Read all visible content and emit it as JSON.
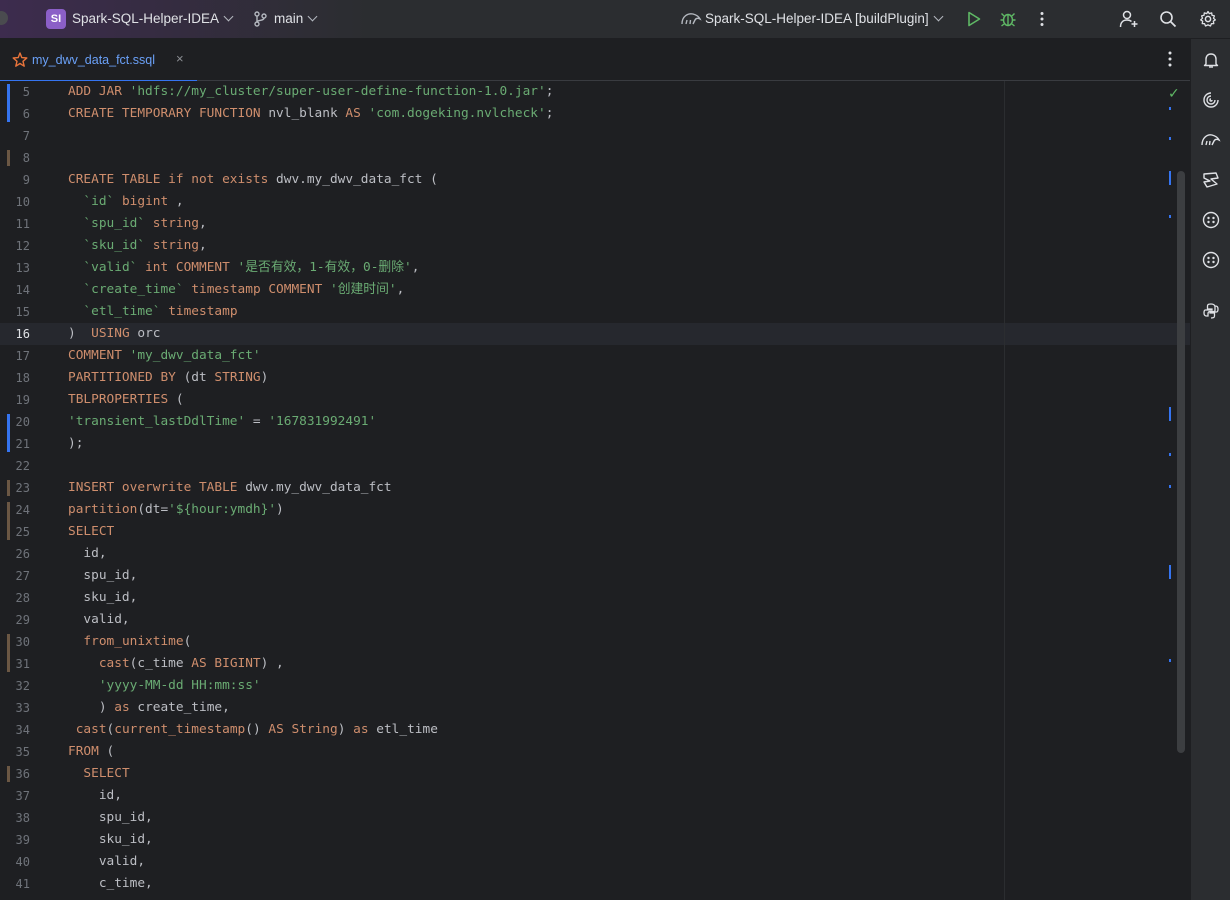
{
  "titlebar": {
    "project_badge": "SI",
    "project_name": "Spark-SQL-Helper-IDEA",
    "branch": "main",
    "run_config": "Spark-SQL-Helper-IDEA [buildPlugin]",
    "icons": [
      "branch-icon",
      "gradle-icon",
      "run-icon",
      "debug-icon",
      "more-vert-icon",
      "add-user-icon",
      "search-icon",
      "settings-icon"
    ]
  },
  "tabs": [
    {
      "label": "my_dwv_data_fct.ssql",
      "active": true,
      "close": "×"
    }
  ],
  "right_toolbar": {
    "icons": [
      "notifications-icon",
      "ai-assistant-icon",
      "gradle-icon",
      "database-icon",
      "plugin-icon",
      "plugin-icon-2",
      "python-console-icon"
    ]
  },
  "editor": {
    "current_line": 16,
    "lines": [
      {
        "n": "5",
        "tokens": [
          [
            "kw",
            "ADD JAR "
          ],
          [
            "str",
            "'hdfs://my_cluster/super-user-define-function-1.0.jar'"
          ],
          [
            "pl",
            ";"
          ]
        ]
      },
      {
        "n": "6",
        "tokens": [
          [
            "kw",
            "CREATE TEMPORARY FUNCTION "
          ],
          [
            "pl",
            "nvl_blank "
          ],
          [
            "kw",
            "AS "
          ],
          [
            "str",
            "'com.dogeking.nvlcheck'"
          ],
          [
            "pl",
            ";"
          ]
        ]
      },
      {
        "n": "7",
        "tokens": []
      },
      {
        "n": "8",
        "tokens": []
      },
      {
        "n": "9",
        "tokens": [
          [
            "kw",
            "CREATE TABLE if not exists "
          ],
          [
            "pl",
            "dwv.my_dwv_data_fct ("
          ]
        ]
      },
      {
        "n": "10",
        "tokens": [
          [
            "pl",
            "  "
          ],
          [
            "str",
            "`id`"
          ],
          [
            "pl",
            " "
          ],
          [
            "kw",
            "bigint"
          ],
          [
            "pl",
            " ,"
          ]
        ]
      },
      {
        "n": "11",
        "tokens": [
          [
            "pl",
            "  "
          ],
          [
            "str",
            "`spu_id`"
          ],
          [
            "pl",
            " "
          ],
          [
            "kw",
            "string"
          ],
          [
            "pl",
            ","
          ]
        ]
      },
      {
        "n": "12",
        "tokens": [
          [
            "pl",
            "  "
          ],
          [
            "str",
            "`sku_id`"
          ],
          [
            "pl",
            " "
          ],
          [
            "kw",
            "string"
          ],
          [
            "pl",
            ","
          ]
        ]
      },
      {
        "n": "13",
        "tokens": [
          [
            "pl",
            "  "
          ],
          [
            "str",
            "`valid`"
          ],
          [
            "pl",
            " "
          ],
          [
            "kw",
            "int COMMENT "
          ],
          [
            "str",
            "'是否有效，1-有效，0-删除'"
          ],
          [
            "pl",
            ","
          ]
        ]
      },
      {
        "n": "14",
        "tokens": [
          [
            "pl",
            "  "
          ],
          [
            "str",
            "`create_time`"
          ],
          [
            "pl",
            " "
          ],
          [
            "kw",
            "timestamp COMMENT "
          ],
          [
            "str",
            "'创建时间'"
          ],
          [
            "pl",
            ","
          ]
        ]
      },
      {
        "n": "15",
        "tokens": [
          [
            "pl",
            "  "
          ],
          [
            "str",
            "`etl_time`"
          ],
          [
            "pl",
            " "
          ],
          [
            "kw",
            "timestamp"
          ]
        ]
      },
      {
        "n": "16",
        "tokens": [
          [
            "pl",
            ")  "
          ],
          [
            "kw",
            "USING "
          ],
          [
            "pl",
            "orc"
          ]
        ]
      },
      {
        "n": "17",
        "tokens": [
          [
            "kw",
            "COMMENT "
          ],
          [
            "str",
            "'my_dwv_data_fct'"
          ]
        ]
      },
      {
        "n": "18",
        "tokens": [
          [
            "kw",
            "PARTITIONED BY "
          ],
          [
            "pl",
            "(dt "
          ],
          [
            "kw",
            "STRING"
          ],
          [
            "pl",
            ")"
          ]
        ]
      },
      {
        "n": "19",
        "tokens": [
          [
            "kw",
            "TBLPROPERTIES "
          ],
          [
            "pl",
            "("
          ]
        ]
      },
      {
        "n": "20",
        "tokens": [
          [
            "str",
            "'transient_lastDdlTime'"
          ],
          [
            "pl",
            " = "
          ],
          [
            "str",
            "'167831992491'"
          ]
        ]
      },
      {
        "n": "21",
        "tokens": [
          [
            "pl",
            ");"
          ]
        ]
      },
      {
        "n": "22",
        "tokens": []
      },
      {
        "n": "23",
        "tokens": [
          [
            "kw",
            "INSERT overwrite TABLE "
          ],
          [
            "pl",
            "dwv.my_dwv_data_fct"
          ]
        ]
      },
      {
        "n": "24",
        "tokens": [
          [
            "fnc",
            "partition"
          ],
          [
            "pl",
            "(dt="
          ],
          [
            "str",
            "'${hour:ymdh}'"
          ],
          [
            "pl",
            ")"
          ]
        ]
      },
      {
        "n": "25",
        "tokens": [
          [
            "kw",
            "SELECT"
          ]
        ]
      },
      {
        "n": "26",
        "tokens": [
          [
            "pl",
            "  id,"
          ]
        ]
      },
      {
        "n": "27",
        "tokens": [
          [
            "pl",
            "  spu_id,"
          ]
        ]
      },
      {
        "n": "28",
        "tokens": [
          [
            "pl",
            "  sku_id,"
          ]
        ]
      },
      {
        "n": "29",
        "tokens": [
          [
            "pl",
            "  valid,"
          ]
        ]
      },
      {
        "n": "30",
        "tokens": [
          [
            "pl",
            "  "
          ],
          [
            "fnc",
            "from_unixtime"
          ],
          [
            "pl",
            "("
          ]
        ]
      },
      {
        "n": "31",
        "tokens": [
          [
            "pl",
            "    "
          ],
          [
            "fnc",
            "cast"
          ],
          [
            "pl",
            "(c_time "
          ],
          [
            "kw",
            "AS BIGINT"
          ],
          [
            "pl",
            ") ,"
          ]
        ]
      },
      {
        "n": "32",
        "tokens": [
          [
            "pl",
            "    "
          ],
          [
            "str",
            "'yyyy-MM-dd HH:mm:ss'"
          ]
        ]
      },
      {
        "n": "33",
        "tokens": [
          [
            "pl",
            "    ) "
          ],
          [
            "kw",
            "as "
          ],
          [
            "pl",
            "create_time,"
          ]
        ]
      },
      {
        "n": "34",
        "tokens": [
          [
            "pl",
            " "
          ],
          [
            "fnc",
            "cast"
          ],
          [
            "pl",
            "("
          ],
          [
            "fnc",
            "current_timestamp"
          ],
          [
            "pl",
            "() "
          ],
          [
            "kw",
            "AS String"
          ],
          [
            "pl",
            ") "
          ],
          [
            "kw",
            "as "
          ],
          [
            "pl",
            "etl_time"
          ]
        ]
      },
      {
        "n": "35",
        "tokens": [
          [
            "kw",
            "FROM "
          ],
          [
            "pl",
            "("
          ]
        ]
      },
      {
        "n": "36",
        "tokens": [
          [
            "pl",
            "  "
          ],
          [
            "kw",
            "SELECT"
          ]
        ]
      },
      {
        "n": "37",
        "tokens": [
          [
            "pl",
            "    id,"
          ]
        ]
      },
      {
        "n": "38",
        "tokens": [
          [
            "pl",
            "    spu_id,"
          ]
        ]
      },
      {
        "n": "39",
        "tokens": [
          [
            "pl",
            "    sku_id,"
          ]
        ]
      },
      {
        "n": "40",
        "tokens": [
          [
            "pl",
            "    valid,"
          ]
        ]
      },
      {
        "n": "41",
        "tokens": [
          [
            "pl",
            "    c_time,"
          ]
        ]
      }
    ]
  },
  "colors": {
    "keyword": "#cf8e6d",
    "string": "#6aab73",
    "plain": "#bcbec4",
    "accent": "#3574f0",
    "background": "#1e1f22"
  }
}
